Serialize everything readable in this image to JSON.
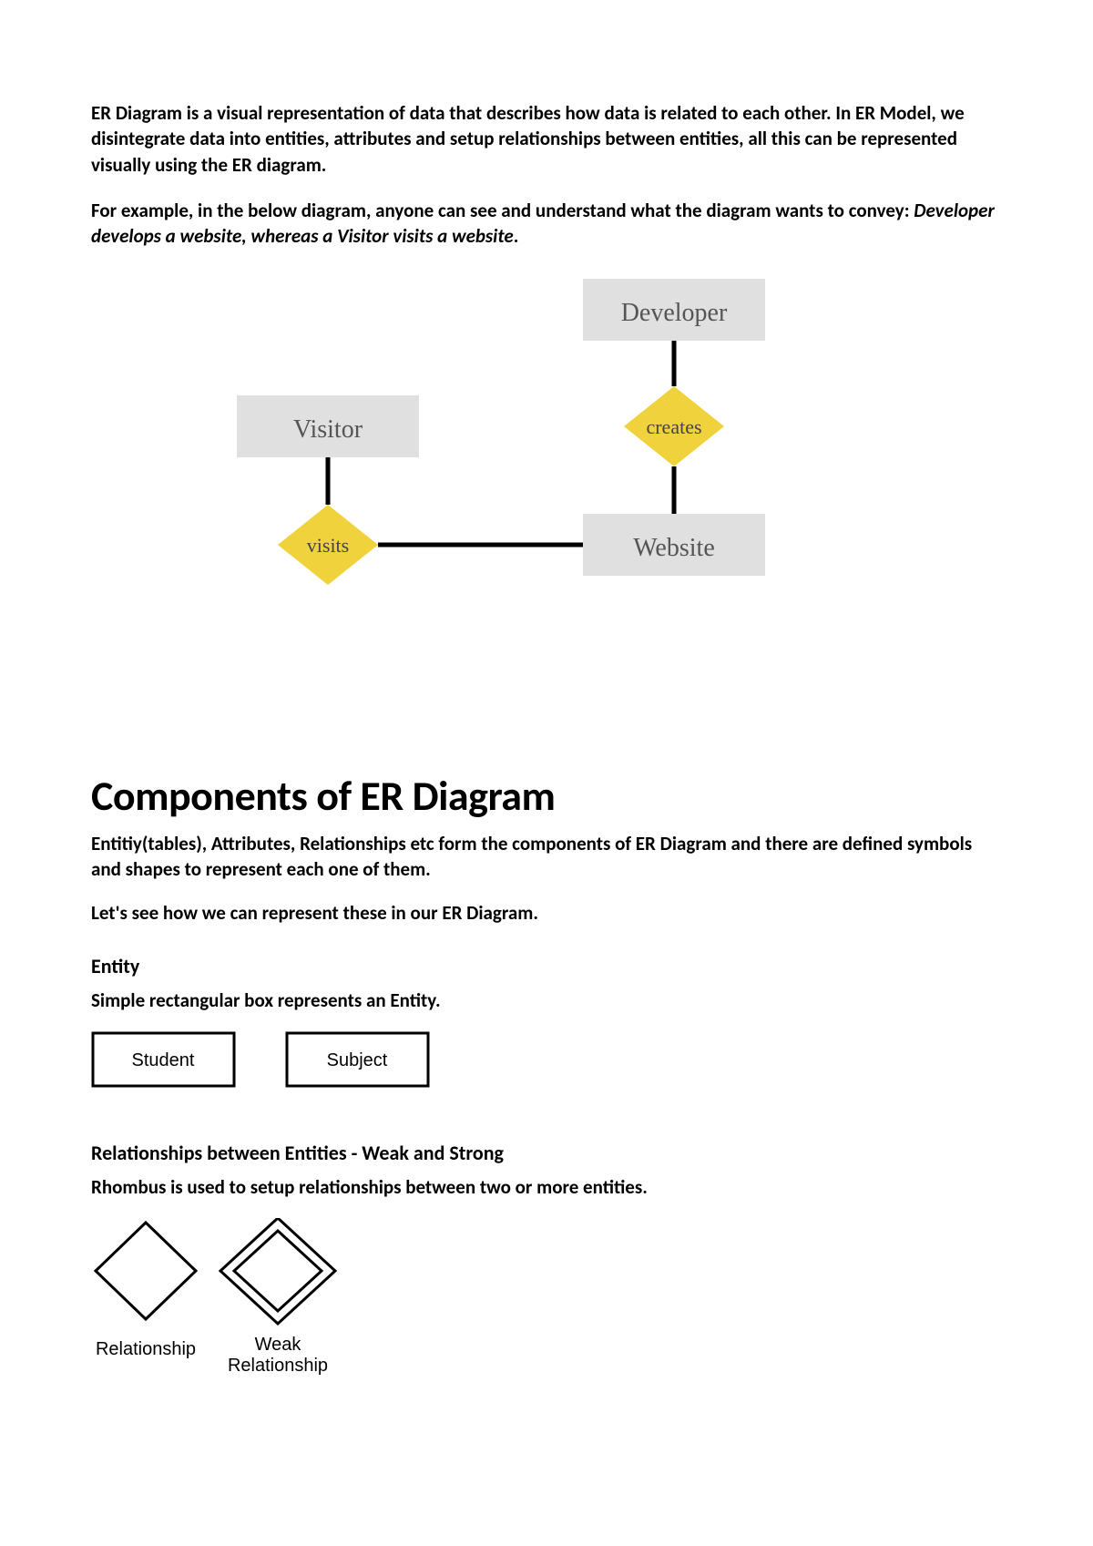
{
  "intro": {
    "p1": "ER Diagram is a visual representation of data that describes how data is related to each other. In ER Model, we disintegrate data into entities, attributes and setup relationships between entities, all this can be represented visually using the ER diagram.",
    "p2_prefix": "For example, in the below diagram, anyone can see and understand what the diagram wants to convey: ",
    "p2_italic": "Developer develops a website, whereas a Visitor visits a website",
    "p2_suffix": "."
  },
  "diagram1": {
    "entity_developer": "Developer",
    "entity_visitor": "Visitor",
    "entity_website": "Website",
    "rel_creates": "creates",
    "rel_visits": "visits"
  },
  "section": {
    "heading": "Components of ER Diagram",
    "p1": "Entitiy(tables), Attributes, Relationships etc form the components of ER Diagram and there are defined symbols and shapes to represent each one of them.",
    "p2": "Let's see how we can represent these in our ER Diagram."
  },
  "entity": {
    "heading": "Entity",
    "desc": "Simple rectangular box represents an Entity.",
    "box1": "Student",
    "box2": "Subject"
  },
  "relationships": {
    "heading": "Relationships between Entities - Weak and Strong",
    "desc": "Rhombus is used to setup relationships between two or more entities.",
    "label1": "Relationship",
    "label2a": "Weak",
    "label2b": "Relationship"
  }
}
